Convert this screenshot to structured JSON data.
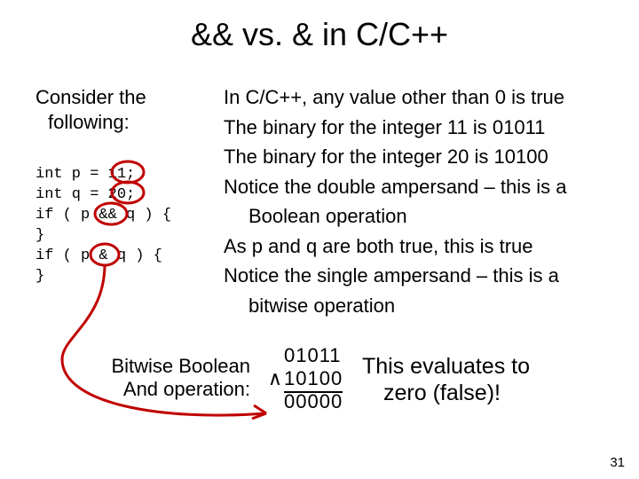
{
  "title": "&& vs. & in C/C++",
  "consider": {
    "line1": "Consider  the",
    "line2": "following:"
  },
  "code": "int p = 11;\nint q = 20;\nif ( p && q ) {\n}\nif ( p & q ) {\n}",
  "right": {
    "p1": "In C/C++, any value other than 0 is true",
    "p2": "The binary for the integer 11 is 01011",
    "p3": "The binary for the integer 20 is 10100",
    "p4a": "Notice the double ampersand – this is a",
    "p4b": "Boolean operation",
    "p5": "As p and q are both true, this is true",
    "p6a": "Notice the single ampersand – this is a",
    "p6b": "bitwise operation"
  },
  "bottom_left": {
    "line1": "Bitwise  Boolean",
    "line2": "And operation:"
  },
  "calc": {
    "a": "01011",
    "wedge": "∧",
    "b": "10100",
    "result": "00000"
  },
  "evaluates": {
    "line1": "This evaluates to",
    "line2": "zero (false)!"
  },
  "slide_number": "31",
  "colors": {
    "annotation": "#C00000"
  }
}
